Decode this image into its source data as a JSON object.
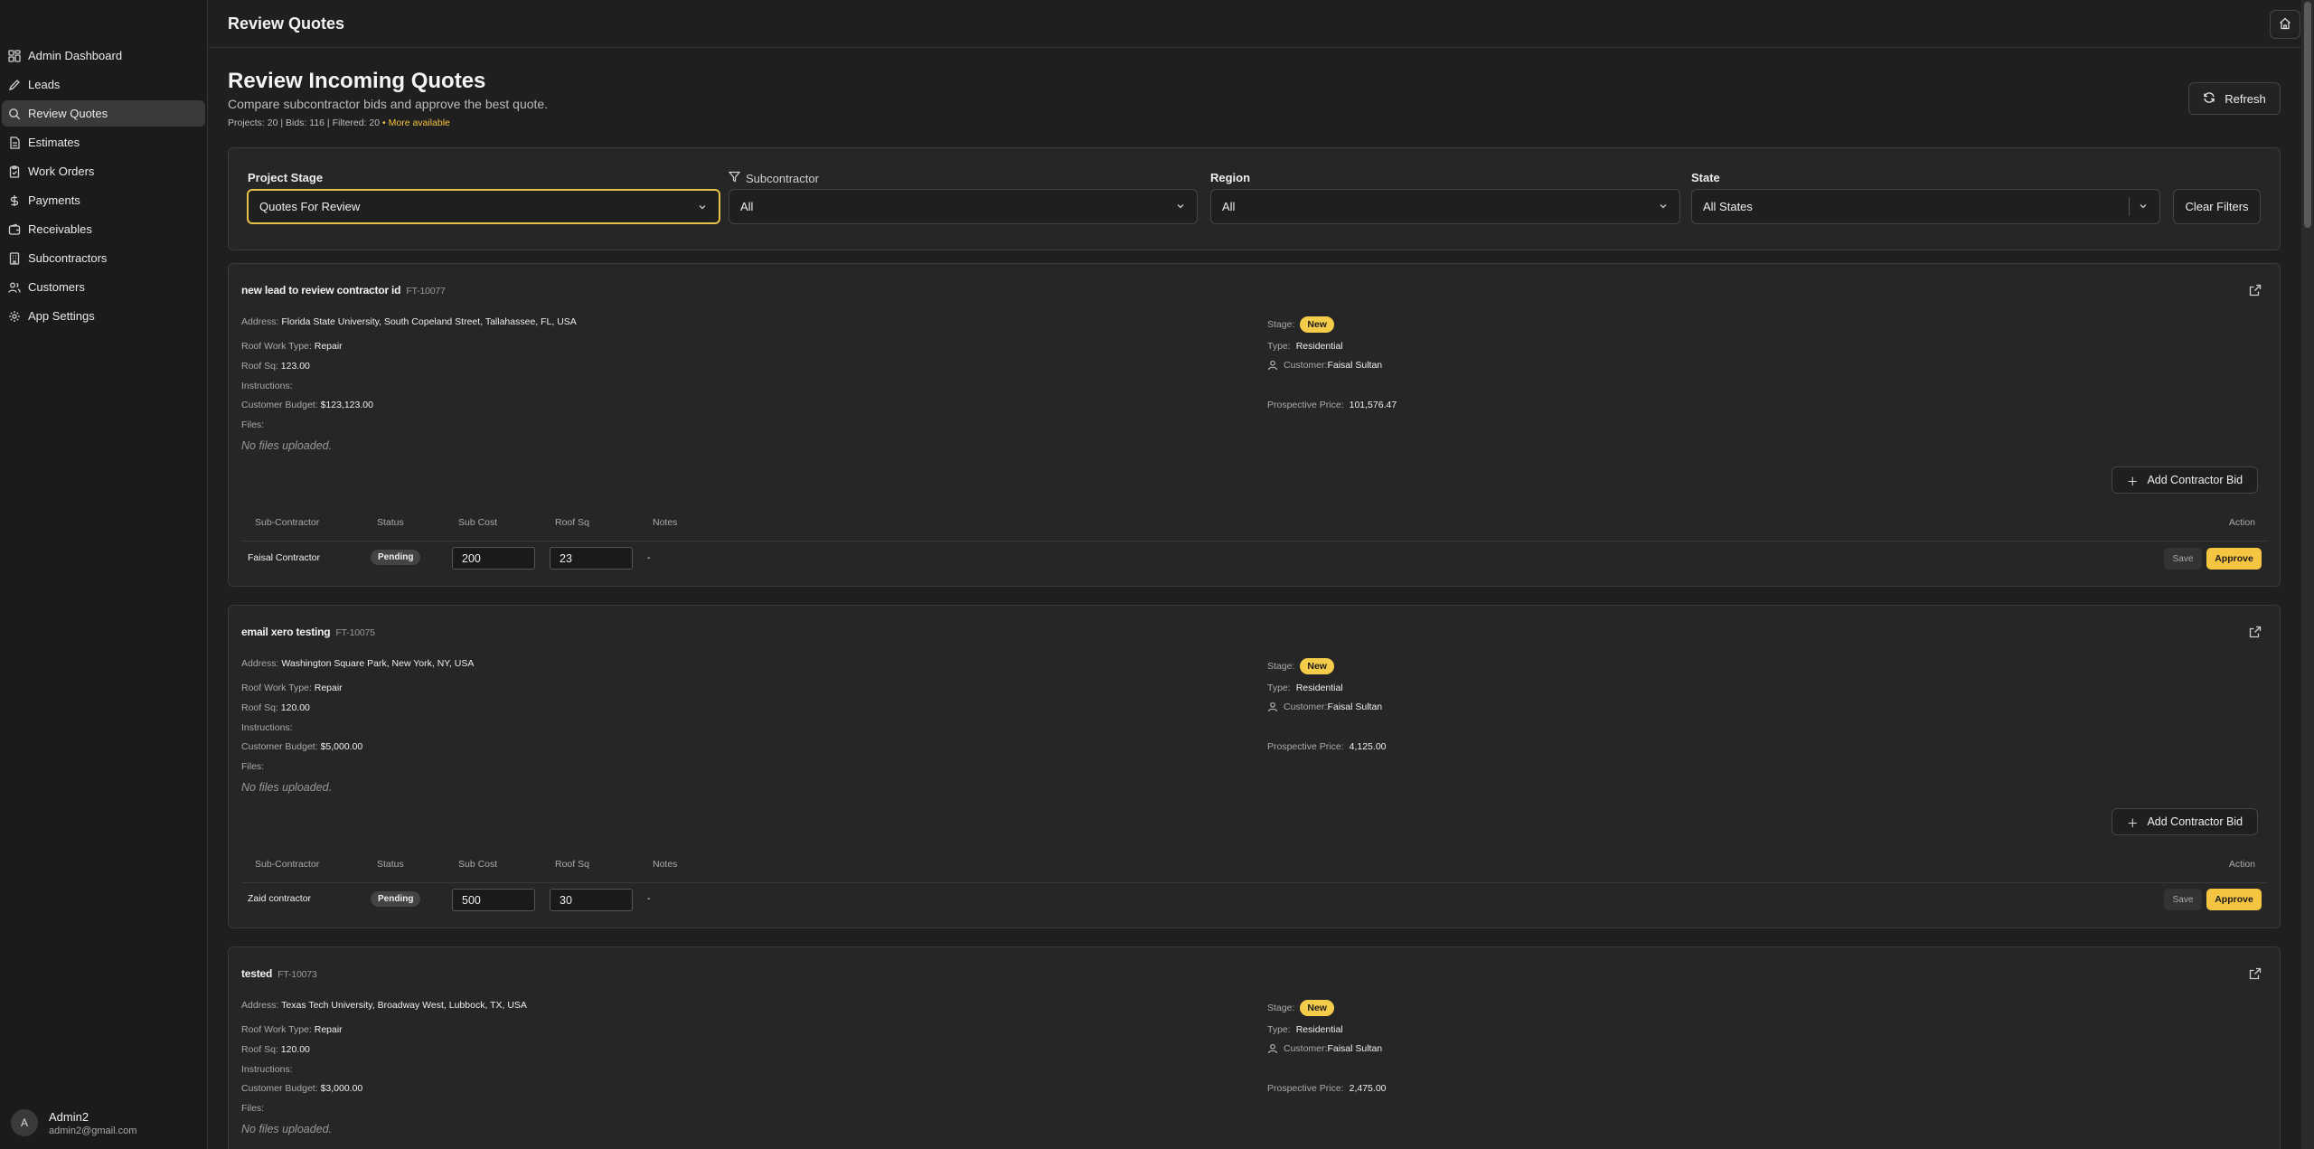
{
  "sidebar": {
    "items": [
      {
        "label": "Admin Dashboard",
        "icon": "dashboard-icon"
      },
      {
        "label": "Leads",
        "icon": "pen-icon"
      },
      {
        "label": "Review Quotes",
        "icon": "search-icon",
        "active": true
      },
      {
        "label": "Estimates",
        "icon": "document-icon"
      },
      {
        "label": "Work Orders",
        "icon": "clipboard-icon"
      },
      {
        "label": "Payments",
        "icon": "dollar-icon"
      },
      {
        "label": "Receivables",
        "icon": "wallet-icon"
      },
      {
        "label": "Subcontractors",
        "icon": "building-icon"
      },
      {
        "label": "Customers",
        "icon": "users-icon"
      },
      {
        "label": "App Settings",
        "icon": "gear-icon"
      }
    ],
    "user": {
      "initial": "A",
      "name": "Admin2",
      "email": "admin2@gmail.com"
    }
  },
  "topbar": {
    "title": "Review Quotes"
  },
  "header": {
    "title": "Review Incoming Quotes",
    "subtitle": "Compare subcontractor bids and approve the best quote.",
    "stats": "Projects: 20 | Bids: 116 | Filtered: 20",
    "more": "• More available",
    "refresh_label": "Refresh"
  },
  "filters": {
    "stage_label": "Project Stage",
    "stage_value": "Quotes For Review",
    "sub_label": "Subcontractor",
    "sub_value": "All",
    "region_label": "Region",
    "region_value": "All",
    "state_label": "State",
    "state_value": "All States",
    "clear_label": "Clear Filters"
  },
  "labels": {
    "address": "Address:",
    "roof_work_type": "Roof Work Type:",
    "roof_sq": "Roof Sq:",
    "instructions": "Instructions:",
    "customer_budget": "Customer Budget:",
    "files": "Files:",
    "stage": "Stage:",
    "type": "Type:",
    "customer": "Customer:",
    "prospective_price": "Prospective Price:",
    "add_bid": "Add Contractor Bid",
    "col_sub": "Sub-Contractor",
    "col_status": "Status",
    "col_cost": "Sub Cost",
    "col_sq": "Roof Sq",
    "col_notes": "Notes",
    "col_action": "Action",
    "save": "Save",
    "approve": "Approve"
  },
  "projects": [
    {
      "title": "new lead to review contractor id",
      "id": "FT-10077",
      "address": "Florida State University, South Copeland Street, Tallahassee, FL, USA",
      "roof_work_type": "Repair",
      "roof_sq": "123.00",
      "customer_budget": "$123,123.00",
      "files_note": "No files uploaded.",
      "stage": "New",
      "type": "Residential",
      "customer": "Faisal Sultan",
      "prospective_price": "101,576.47",
      "bids": [
        {
          "sub": "Faisal Contractor",
          "status": "Pending",
          "cost": "200",
          "sq": "23",
          "notes": "-"
        }
      ]
    },
    {
      "title": "email xero testing",
      "id": "FT-10075",
      "address": "Washington Square Park, New York, NY, USA",
      "roof_work_type": "Repair",
      "roof_sq": "120.00",
      "customer_budget": "$5,000.00",
      "files_note": "No files uploaded.",
      "stage": "New",
      "type": "Residential",
      "customer": "Faisal Sultan",
      "prospective_price": "4,125.00",
      "bids": [
        {
          "sub": "Zaid contractor",
          "status": "Pending",
          "cost": "500",
          "sq": "30",
          "notes": "-"
        }
      ]
    },
    {
      "title": "tested",
      "id": "FT-10073",
      "address": "Texas Tech University, Broadway West, Lubbock, TX, USA",
      "roof_work_type": "Repair",
      "roof_sq": "120.00",
      "customer_budget": "$3,000.00",
      "files_note": "No files uploaded.",
      "stage": "New",
      "type": "Residential",
      "customer": "Faisal Sultan",
      "prospective_price": "2,475.00"
    }
  ]
}
